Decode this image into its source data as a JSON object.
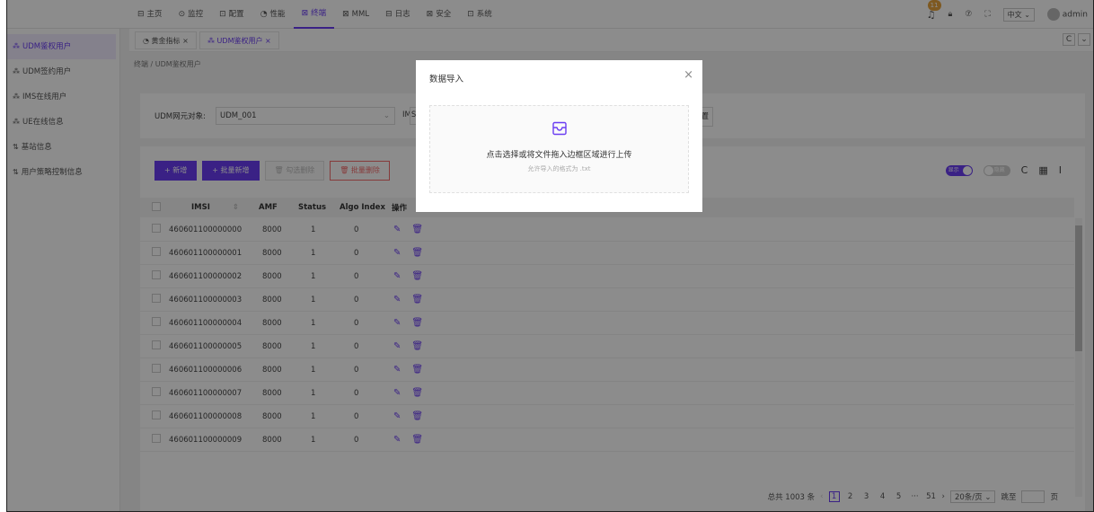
{
  "nav": {
    "items": [
      {
        "icon": "⊟",
        "label": "主页"
      },
      {
        "icon": "⊙",
        "label": "监控"
      },
      {
        "icon": "⊡",
        "label": "配置"
      },
      {
        "icon": "◔",
        "label": "性能"
      },
      {
        "icon": "⊠",
        "label": "终端"
      },
      {
        "icon": "⊠",
        "label": "MML"
      },
      {
        "icon": "⊟",
        "label": "日志"
      },
      {
        "icon": "⊠",
        "label": "安全"
      },
      {
        "icon": "⊡",
        "label": "系统"
      }
    ],
    "active_index": 4
  },
  "topright": {
    "badge": "11",
    "lang": "中文",
    "user": "admin"
  },
  "sidebar": {
    "items": [
      {
        "icon": "⁂",
        "label": "UDM鉴权用户"
      },
      {
        "icon": "⁂",
        "label": "UDM签约用户"
      },
      {
        "icon": "⁂",
        "label": "IMS在线用户"
      },
      {
        "icon": "⁂",
        "label": "UE在线信息"
      },
      {
        "icon": "⇅",
        "label": "基站信息"
      },
      {
        "icon": "⇅",
        "label": "用户策略控制信息"
      }
    ]
  },
  "tabs": [
    {
      "label": "黄金指标"
    },
    {
      "label": "UDM鉴权用户"
    }
  ],
  "breadcrumb": "终端 / UDM鉴权用户",
  "filter": {
    "ne_label": "UDM网元对象:",
    "ne_value": "UDM_001",
    "imsi_label": "IMSI:",
    "reset_label": "置"
  },
  "toolbar": {
    "add": "+ 新增",
    "batch_add": "+ 批量新增",
    "delete_checked": "勾选删除",
    "batch_delete": "批量删除",
    "switch_on": "显示",
    "switch_off": "隐藏"
  },
  "table": {
    "headers": {
      "imsi": "IMSI",
      "amf": "AMF",
      "status": "Status",
      "algo": "Algo Index",
      "op": "操作"
    },
    "rows": [
      {
        "imsi": "460601100000000",
        "amf": "8000",
        "status": "1",
        "algo": "0"
      },
      {
        "imsi": "460601100000001",
        "amf": "8000",
        "status": "1",
        "algo": "0"
      },
      {
        "imsi": "460601100000002",
        "amf": "8000",
        "status": "1",
        "algo": "0"
      },
      {
        "imsi": "460601100000003",
        "amf": "8000",
        "status": "1",
        "algo": "0"
      },
      {
        "imsi": "460601100000004",
        "amf": "8000",
        "status": "1",
        "algo": "0"
      },
      {
        "imsi": "460601100000005",
        "amf": "8000",
        "status": "1",
        "algo": "0"
      },
      {
        "imsi": "460601100000006",
        "amf": "8000",
        "status": "1",
        "algo": "0"
      },
      {
        "imsi": "460601100000007",
        "amf": "8000",
        "status": "1",
        "algo": "0"
      },
      {
        "imsi": "460601100000008",
        "amf": "8000",
        "status": "1",
        "algo": "0"
      },
      {
        "imsi": "460601100000009",
        "amf": "8000",
        "status": "1",
        "algo": "0"
      }
    ]
  },
  "pager": {
    "total": "总共 1003 条",
    "pages": [
      "1",
      "2",
      "3",
      "4",
      "5",
      "···",
      "51"
    ],
    "current": "1",
    "page_size": "20条/页",
    "goto_label": "跳至",
    "page_suffix": "页"
  },
  "modal": {
    "title": "数据导入",
    "drop_text": "点击选择或将文件拖入边框区域进行上传",
    "drop_hint": "允许导入的格式为 .txt"
  },
  "colors": {
    "accent": "#6a3df2",
    "danger": "#f56c6c",
    "badge": "#e6a23c"
  }
}
